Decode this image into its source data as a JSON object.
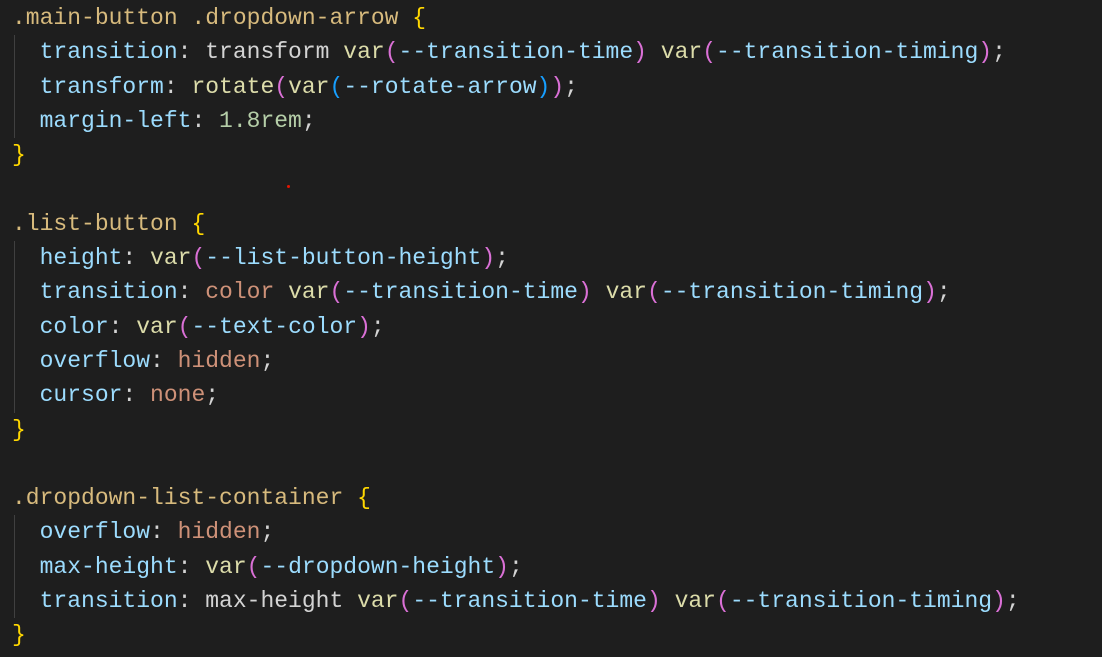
{
  "colors": {
    "background": "#1e1e1e",
    "selector": "#d7ba7d",
    "property": "#9cdcfe",
    "value": "#ce9178",
    "function": "#dcdcaa",
    "number": "#b5cea8"
  },
  "lines": [
    {
      "indent": false,
      "tokens": [
        {
          "t": ".main-button .dropdown-arrow ",
          "c": "sel"
        },
        {
          "t": "{",
          "c": "b1"
        }
      ]
    },
    {
      "indent": true,
      "tokens": [
        {
          "t": "  transition",
          "c": "prop"
        },
        {
          "t": ": transform ",
          "c": "plain"
        },
        {
          "t": "var",
          "c": "fn"
        },
        {
          "t": "(",
          "c": "b2"
        },
        {
          "t": "--transition-time",
          "c": "vr"
        },
        {
          "t": ")",
          "c": "b2"
        },
        {
          "t": " ",
          "c": "plain"
        },
        {
          "t": "var",
          "c": "fn"
        },
        {
          "t": "(",
          "c": "b2"
        },
        {
          "t": "--transition-timing",
          "c": "vr"
        },
        {
          "t": ")",
          "c": "b2"
        },
        {
          "t": ";",
          "c": "plain"
        }
      ]
    },
    {
      "indent": true,
      "tokens": [
        {
          "t": "  transform",
          "c": "prop"
        },
        {
          "t": ": ",
          "c": "plain"
        },
        {
          "t": "rotate",
          "c": "fn"
        },
        {
          "t": "(",
          "c": "b2"
        },
        {
          "t": "var",
          "c": "fn"
        },
        {
          "t": "(",
          "c": "b3"
        },
        {
          "t": "--rotate-arrow",
          "c": "vr"
        },
        {
          "t": ")",
          "c": "b3"
        },
        {
          "t": ")",
          "c": "b2"
        },
        {
          "t": ";",
          "c": "plain"
        }
      ]
    },
    {
      "indent": true,
      "tokens": [
        {
          "t": "  margin-left",
          "c": "prop"
        },
        {
          "t": ": ",
          "c": "plain"
        },
        {
          "t": "1.8rem",
          "c": "num"
        },
        {
          "t": ";",
          "c": "plain"
        }
      ]
    },
    {
      "indent": false,
      "tokens": [
        {
          "t": "}",
          "c": "b1"
        }
      ]
    },
    {
      "indent": false,
      "tokens": []
    },
    {
      "indent": false,
      "tokens": [
        {
          "t": ".list-button ",
          "c": "sel"
        },
        {
          "t": "{",
          "c": "b1"
        }
      ]
    },
    {
      "indent": true,
      "tokens": [
        {
          "t": "  height",
          "c": "prop"
        },
        {
          "t": ": ",
          "c": "plain"
        },
        {
          "t": "var",
          "c": "fn"
        },
        {
          "t": "(",
          "c": "b2"
        },
        {
          "t": "--list-button-height",
          "c": "vr"
        },
        {
          "t": ")",
          "c": "b2"
        },
        {
          "t": ";",
          "c": "plain"
        }
      ]
    },
    {
      "indent": true,
      "tokens": [
        {
          "t": "  transition",
          "c": "prop"
        },
        {
          "t": ": ",
          "c": "plain"
        },
        {
          "t": "color",
          "c": "val"
        },
        {
          "t": " ",
          "c": "plain"
        },
        {
          "t": "var",
          "c": "fn"
        },
        {
          "t": "(",
          "c": "b2"
        },
        {
          "t": "--transition-time",
          "c": "vr"
        },
        {
          "t": ")",
          "c": "b2"
        },
        {
          "t": " ",
          "c": "plain"
        },
        {
          "t": "var",
          "c": "fn"
        },
        {
          "t": "(",
          "c": "b2"
        },
        {
          "t": "--transition-timing",
          "c": "vr"
        },
        {
          "t": ")",
          "c": "b2"
        },
        {
          "t": ";",
          "c": "plain"
        }
      ]
    },
    {
      "indent": true,
      "tokens": [
        {
          "t": "  color",
          "c": "prop"
        },
        {
          "t": ": ",
          "c": "plain"
        },
        {
          "t": "var",
          "c": "fn"
        },
        {
          "t": "(",
          "c": "b2"
        },
        {
          "t": "--text-color",
          "c": "vr"
        },
        {
          "t": ")",
          "c": "b2"
        },
        {
          "t": ";",
          "c": "plain"
        }
      ]
    },
    {
      "indent": true,
      "tokens": [
        {
          "t": "  overflow",
          "c": "prop"
        },
        {
          "t": ": ",
          "c": "plain"
        },
        {
          "t": "hidden",
          "c": "val"
        },
        {
          "t": ";",
          "c": "plain"
        }
      ]
    },
    {
      "indent": true,
      "tokens": [
        {
          "t": "  cursor",
          "c": "prop"
        },
        {
          "t": ": ",
          "c": "plain"
        },
        {
          "t": "none",
          "c": "val"
        },
        {
          "t": ";",
          "c": "plain"
        }
      ]
    },
    {
      "indent": false,
      "tokens": [
        {
          "t": "}",
          "c": "b1"
        }
      ]
    },
    {
      "indent": false,
      "tokens": []
    },
    {
      "indent": false,
      "tokens": [
        {
          "t": ".dropdown-list-container ",
          "c": "sel"
        },
        {
          "t": "{",
          "c": "b1"
        }
      ]
    },
    {
      "indent": true,
      "tokens": [
        {
          "t": "  overflow",
          "c": "prop"
        },
        {
          "t": ": ",
          "c": "plain"
        },
        {
          "t": "hidden",
          "c": "val"
        },
        {
          "t": ";",
          "c": "plain"
        }
      ]
    },
    {
      "indent": true,
      "tokens": [
        {
          "t": "  max-height",
          "c": "prop"
        },
        {
          "t": ": ",
          "c": "plain"
        },
        {
          "t": "var",
          "c": "fn"
        },
        {
          "t": "(",
          "c": "b2"
        },
        {
          "t": "--dropdown-height",
          "c": "vr"
        },
        {
          "t": ")",
          "c": "b2"
        },
        {
          "t": ";",
          "c": "plain"
        }
      ]
    },
    {
      "indent": true,
      "tokens": [
        {
          "t": "  transition",
          "c": "prop"
        },
        {
          "t": ": max-height ",
          "c": "plain"
        },
        {
          "t": "var",
          "c": "fn"
        },
        {
          "t": "(",
          "c": "b2"
        },
        {
          "t": "--transition-time",
          "c": "vr"
        },
        {
          "t": ")",
          "c": "b2"
        },
        {
          "t": " ",
          "c": "plain"
        },
        {
          "t": "var",
          "c": "fn"
        },
        {
          "t": "(",
          "c": "b2"
        },
        {
          "t": "--transition-timing",
          "c": "vr"
        },
        {
          "t": ")",
          "c": "b2"
        },
        {
          "t": ";",
          "c": "plain"
        }
      ]
    },
    {
      "indent": false,
      "tokens": [
        {
          "t": "}",
          "c": "b1"
        }
      ]
    }
  ]
}
